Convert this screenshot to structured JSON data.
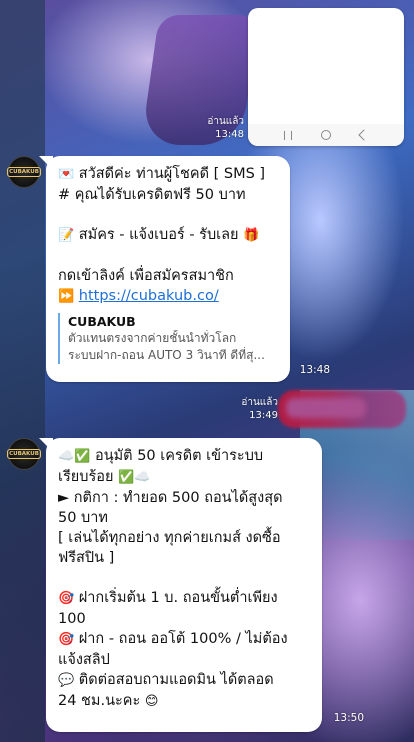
{
  "top_message": {
    "read_status": "อ่านแล้ว",
    "time": "13:48"
  },
  "message1": {
    "line1_icon": "💌",
    "line1": "สวัสดีค่ะ ท่านผู้โชคดี [ SMS ]",
    "line2": "# คุณได้รับเครดิตฟรี 50 บาท",
    "line3_icon": "📝",
    "line3": "สมัคร - แจ้งเบอร์ - รับเลย",
    "line3_end_icon": "🎁",
    "line4": "กดเข้าลิงค์ เพื่อสมัครสมาชิก",
    "link_icon": "⏩",
    "link": "https://cubakub.co/",
    "preview_title": "CUBAKUB",
    "preview_line1": "ตัวแทนตรงจากค่ายชั้นนำทั่วโลก",
    "preview_line2": "ระบบฝาก-ถอน AUTO 3 วินาที ดีที่สุ...",
    "time": "13:48"
  },
  "outgoing": {
    "read_status": "อ่านแล้ว",
    "time": "13:49"
  },
  "message2": {
    "line1_icons": "☁️✅",
    "line1": "อนุมัติ 50 เครดิต เข้าระบบ",
    "line2": "เรียบร้อย",
    "line2_icons": "✅☁️",
    "line3": "► กติกา : ทำยอด 500 ถอนได้สูงสุด",
    "line4": "50 บาท",
    "line5": "[ เล่นได้ทุกอย่าง ทุกค่ายเกมส์ งดซื้อ",
    "line6": "ฟรีสปิน ]",
    "line7_icon": "🎯",
    "line7": "ฝากเริ่มต้น 1 บ. ถอนขั้นต่ำเพียง",
    "line8": "100",
    "line9_icon": "🎯",
    "line9": "ฝาก - ถอน ออโต้ 100% / ไม่ต้อง",
    "line10": "แจ้งสลิป",
    "line11_icon": "💬",
    "line11": "ติดต่อสอบถามแอดมิน ได้ตลอด",
    "line12": "24 ชม.นะคะ",
    "line12_icon": "😊",
    "time": "13:50"
  },
  "avatar_text": "CUBAKUB",
  "colors": {
    "link": "#1f6fd6",
    "preview_bar": "#6aa9e5"
  }
}
